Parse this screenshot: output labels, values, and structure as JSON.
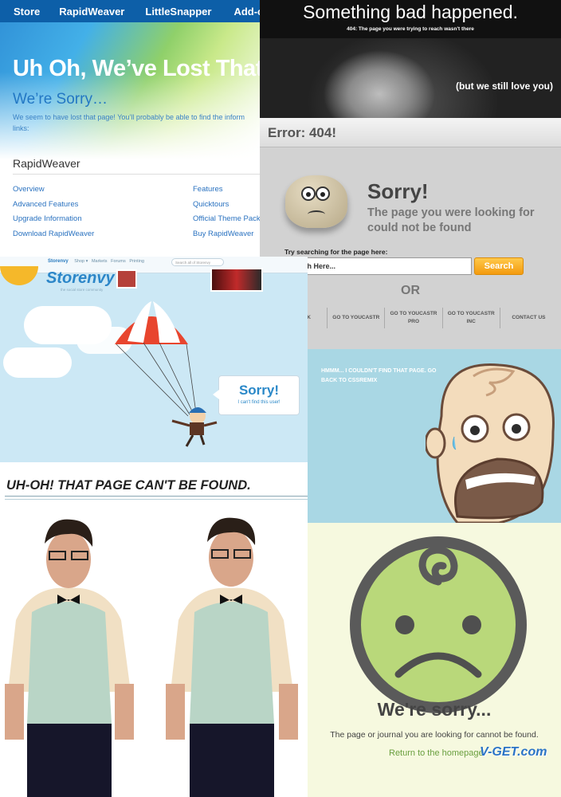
{
  "rapidweaver": {
    "nav": [
      "Store",
      "RapidWeaver",
      "LittleSnapper",
      "Add-on"
    ],
    "heading": "Uh Oh, We’ve Lost That",
    "subheading": "We’re Sorry…",
    "body": "We seem to have lost that page! You’ll probably be able to find the inform links:",
    "section_title": "RapidWeaver",
    "links_left": [
      "Overview",
      "Advanced Features",
      "Upgrade Information",
      "Download RapidWeaver"
    ],
    "links_right": [
      "Features",
      "Quicktours",
      "Official Theme Pack",
      "Buy RapidWeaver"
    ]
  },
  "bad": {
    "title": "Something bad happened.",
    "subtitle": "404: The page you were trying to reach wasn't there",
    "caption": "(but we still love you)"
  },
  "error404": {
    "title": "Error: 404!",
    "sorry": "Sorry!",
    "message": "The page you were looking for could not be found",
    "search_label": "Try searching for the page here:",
    "search_placeholder": "Search Here...",
    "search_button": "Search",
    "or": "OR",
    "links": [
      "GO BACK",
      "GO TO YOUCASTR",
      "GO TO YOUCASTR PRO",
      "GO TO YOUCASTR INC",
      "CONTACT US"
    ]
  },
  "storenvy": {
    "logo": "Storenvy",
    "tagline": "the social store community",
    "nav_brand": "Storenvy",
    "nav": [
      "Shop ▾",
      "Markets",
      "Forums",
      "Printing"
    ],
    "search_placeholder": "Search all of Storenvy",
    "sorry": "Sorry!",
    "sorry_sub": "I can't find this user!"
  },
  "cssremix": {
    "text": "HMMM... I COULDN'T FIND THAT PAGE. GO BACK TO CSSREMIX"
  },
  "uhoh": {
    "heading": "UH-OH! THAT PAGE CAN'T BE FOUND."
  },
  "weresorry": {
    "heading": "We're sorry...",
    "message": "The page or journal you are looking for cannot be found.",
    "link": "Return to the homepage",
    "watermark": "V-GET.com"
  },
  "colors": {
    "rw_nav": "#0d5fa8",
    "search_orange": "#f39a0f",
    "smiley_green": "#b9d87a",
    "smiley_ring": "#5a5a5a"
  }
}
